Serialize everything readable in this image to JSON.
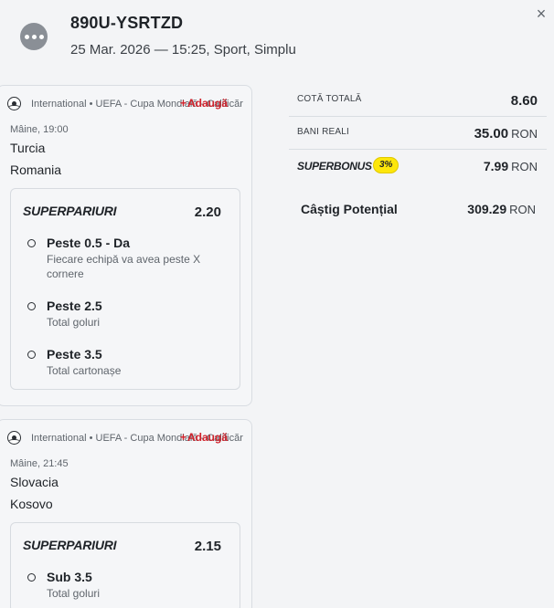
{
  "header": {
    "ticket_id": "890U-YSRTZD",
    "subtitle": "25 Mar. 2026 — 15:25, Sport, Simplu",
    "close_icon": "×",
    "menu_icon": "more-horizontal-icon"
  },
  "events": [
    {
      "league": "International • UEFA - Cupa Mondială - Calificări",
      "add_label": "Adaugă",
      "add_icon": "+",
      "time": "Mâine, 19:00",
      "home_team": "Turcia",
      "away_team": "Romania",
      "super_title": "SUPERPARIURI",
      "super_odd": "2.20",
      "selections": [
        {
          "name": "Peste 0.5 - Da",
          "desc": "Fiecare echipă va avea peste X cornere"
        },
        {
          "name": "Peste 2.5",
          "desc": "Total goluri"
        },
        {
          "name": "Peste 3.5",
          "desc": "Total cartonașe"
        }
      ]
    },
    {
      "league": "International • UEFA - Cupa Mondială - Calificări",
      "add_label": "Adaugă",
      "add_icon": "+",
      "time": "Mâine, 21:45",
      "home_team": "Slovacia",
      "away_team": "Kosovo",
      "super_title": "SUPERPARIURI",
      "super_odd": "2.15",
      "selections": [
        {
          "name": "Sub 3.5",
          "desc": "Total goluri"
        }
      ]
    }
  ],
  "summary": {
    "total_odds_label": "COTĂ TOTALĂ",
    "total_odds_value": "8.60",
    "real_money_label": "BANI REALI",
    "real_money_value": "35.00",
    "currency": "RON",
    "superbonus_label": "SUPERBONUS",
    "superbonus_badge": "3%",
    "superbonus_value": "7.99",
    "potential_win_label": "Câștig Potențial",
    "potential_win_value": "309.29"
  },
  "colors": {
    "accent_red": "#d0202a",
    "badge_yellow": "#fde60a",
    "background": "#f3f4f6"
  }
}
